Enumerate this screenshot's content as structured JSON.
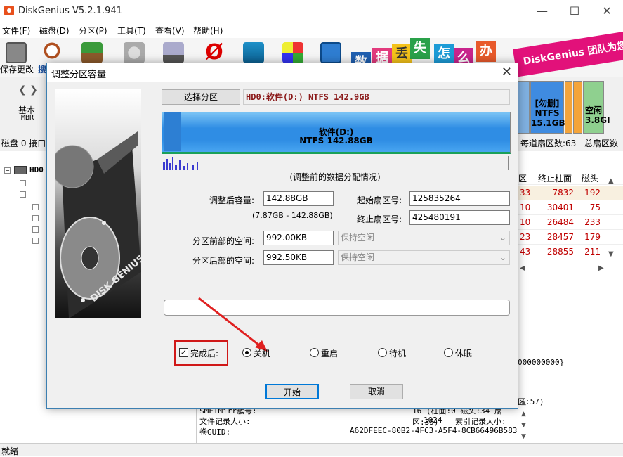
{
  "app": {
    "title": "DiskGenius V5.2.1.941"
  },
  "menu": [
    "文件(F)",
    "磁盘(D)",
    "分区(P)",
    "工具(T)",
    "查看(V)",
    "帮助(H)"
  ],
  "toolbar": {
    "save_label": "保存更改",
    "search_label": "搜"
  },
  "banner": {
    "tiles": [
      "数",
      "据",
      "丢",
      "失",
      "怎",
      "么",
      "办"
    ],
    "strip": "DiskGenius 团队为您"
  },
  "disk": {
    "basic": "基本",
    "mbr": "MBR",
    "iface": "磁盘 0 接口",
    "blocks": [
      {
        "l1": "[勿删]",
        "l2": "NTFS",
        "l3": "15.1GB"
      },
      {
        "l1": "空闲",
        "l2": "",
        "l3": "3.8GI"
      }
    ],
    "sectors_per_track": "每道扇区数:63",
    "total_sectors": "总扇区数"
  },
  "tree": {
    "root": "HD0"
  },
  "table": {
    "headers": [
      "区",
      "终止柱面",
      "磁头"
    ],
    "rows": [
      [
        "33",
        "7832",
        "192"
      ],
      [
        "10",
        "30401",
        "75"
      ],
      [
        "10",
        "26484",
        "233"
      ],
      [
        "23",
        "28457",
        "179"
      ],
      [
        "43",
        "28855",
        "211"
      ]
    ]
  },
  "right_extras": {
    "hex": "000000000}",
    "sector": "区:57)"
  },
  "bottom_info": {
    "rows": [
      {
        "k": "$MFTMirr簇号:",
        "v": "16 (柱面:0 磁头:34 扇区:35)"
      },
      {
        "k": "文件记录大小:",
        "v": "1024",
        "k2": "索引记录大小:"
      },
      {
        "k": "卷GUID:",
        "v": "A62DFEEC-80B2-4FC3-A5F4-8CB66496B583"
      }
    ]
  },
  "status": "就绪",
  "dialog": {
    "title": "调整分区容量",
    "select_partition": "选择分区",
    "partition_header": "HD0:软件(D:) NTFS 142.9GB",
    "partition_name": "软件(D:)",
    "partition_info": "NTFS 142.88GB",
    "chart_caption": "(调整前的数据分配情况)",
    "fields": {
      "size_label": "调整后容量:",
      "size_value": "142.88GB",
      "range": "(7.87GB - 142.88GB)",
      "start_label": "起始扇区号:",
      "start_value": "125835264",
      "end_label": "终止扇区号:",
      "end_value": "425480191",
      "before_label": "分区前部的空间:",
      "before_value": "992.00KB",
      "before_opt": "保持空闲",
      "after_label": "分区后部的空间:",
      "after_value": "992.50KB",
      "after_opt": "保持空闲"
    },
    "after_completion": "完成后:",
    "radios": [
      {
        "label": "关机",
        "checked": true
      },
      {
        "label": "重启",
        "checked": false
      },
      {
        "label": "待机",
        "checked": false
      },
      {
        "label": "休眠",
        "checked": false
      }
    ],
    "ok": "开始",
    "cancel": "取消",
    "watermark": "DISK GENIUS"
  },
  "colors": {
    "accent": "#0078d7",
    "arrow": "#e02020",
    "partition": "#2f8de4"
  }
}
